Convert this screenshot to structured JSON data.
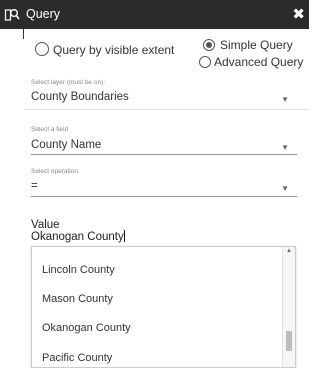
{
  "header": {
    "title": "Query",
    "close_symbol": "✖"
  },
  "extent_option": {
    "label": "Query by visible extent",
    "checked": false
  },
  "mode_options": [
    {
      "label": "Simple Query",
      "checked": true
    },
    {
      "label": "Advanced Query",
      "checked": false
    }
  ],
  "layer": {
    "label": "Select layer (must be on):",
    "value": "County Boundaries"
  },
  "field": {
    "label": "Select a field",
    "value": "County Name"
  },
  "operation": {
    "label": "Select operation:",
    "value": "="
  },
  "value_input": {
    "label": "Value",
    "value": "Okanogan County"
  },
  "dropdown": {
    "items": [
      "Lincoln County",
      "Mason County",
      "Okanogan County",
      "Pacific County"
    ]
  },
  "icons": {
    "header": "query-search-icon",
    "caret": "caret-down-icon",
    "scroll_up": "scroll-up-arrow-icon"
  },
  "colors": {
    "header_bg": "#2b2b2b",
    "header_text": "#ffffff"
  }
}
